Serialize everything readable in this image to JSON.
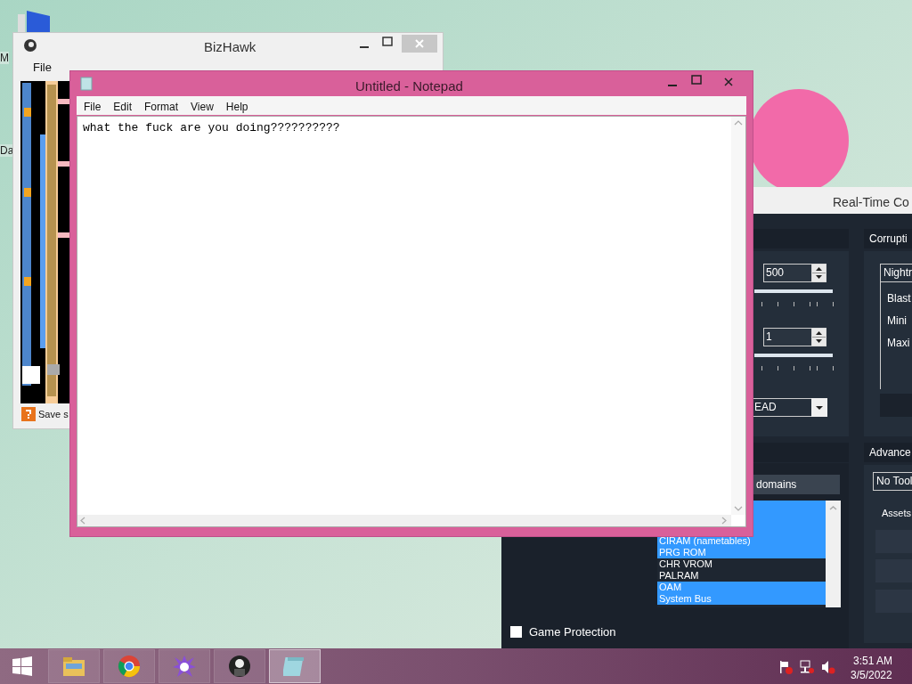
{
  "desktop": {
    "icon_labels": [
      "M",
      "Da"
    ]
  },
  "bizhawk": {
    "title": "BizHawk",
    "menu": [
      "File"
    ],
    "status_text": "Save s"
  },
  "rtc": {
    "title": "Real-Time Co",
    "spin_fields": [
      {
        "value": "500"
      },
      {
        "value": "1"
      }
    ],
    "dropdown": "EAD",
    "corruption_header": "Corrupti",
    "engine_tab": "Nightr",
    "engine_labels": [
      "Blast",
      "Mini",
      "Maxi"
    ],
    "domains_label": "domains",
    "domains": [
      {
        "selected": true
      },
      {
        "selected": true
      },
      {
        "selected": true
      },
      {
        "label": "CIRAM (nametables)",
        "selected": true
      },
      {
        "label": "PRG ROM",
        "selected": true
      },
      {
        "label": "CHR VROM",
        "selected": false
      },
      {
        "label": "PALRAM",
        "selected": false
      },
      {
        "label": "OAM",
        "selected": true
      },
      {
        "label": "System Bus",
        "selected": true
      }
    ],
    "advanced_header": "Advance",
    "tool_dropdown": "No Tool",
    "assets_label": "Assets",
    "game_protection": {
      "label": "Game Protection",
      "checked": false
    }
  },
  "notepad": {
    "title": "Untitled - Notepad",
    "menu": [
      "File",
      "Edit",
      "Format",
      "View",
      "Help"
    ],
    "text": "what the fuck are you doing??????????"
  },
  "taskbar": {
    "apps": [
      {
        "kind": "start",
        "selected": false
      },
      {
        "kind": "folder",
        "selected": false
      },
      {
        "kind": "browser",
        "selected": false
      },
      {
        "kind": "spiky",
        "selected": false
      },
      {
        "kind": "figure",
        "selected": false
      },
      {
        "kind": "notepad",
        "selected": true
      }
    ],
    "time": "3:51 AM",
    "date": "3/5/2022"
  }
}
